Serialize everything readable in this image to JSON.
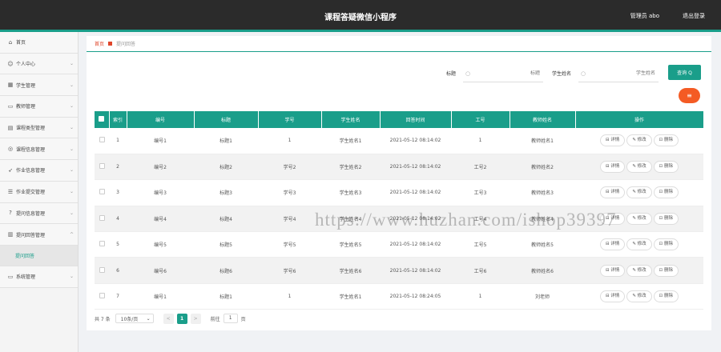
{
  "header": {
    "title": "课程答疑微信小程序",
    "user": "管理员 abo",
    "logout": "退出登录"
  },
  "sidebar": {
    "items": [
      {
        "label": "首页",
        "icon": "home-icon",
        "glyph": "⌂"
      },
      {
        "label": "个人中心",
        "icon": "person-icon",
        "glyph": "☺"
      },
      {
        "label": "学生管理",
        "icon": "grid-icon",
        "glyph": "▦"
      },
      {
        "label": "教师管理",
        "icon": "card-icon",
        "glyph": "▭"
      },
      {
        "label": "课程类型管理",
        "icon": "list-icon",
        "glyph": "▤"
      },
      {
        "label": "课程信息管理",
        "icon": "globe-icon",
        "glyph": "◎"
      },
      {
        "label": "作业信息管理",
        "icon": "send-icon",
        "glyph": "➶"
      },
      {
        "label": "作业提交管理",
        "icon": "stack-icon",
        "glyph": "☰"
      },
      {
        "label": "提问信息管理",
        "icon": "question-icon",
        "glyph": "?"
      },
      {
        "label": "提问回答管理",
        "icon": "doc-icon",
        "glyph": "▥"
      }
    ],
    "sub_item": "提问回答",
    "last_item": {
      "label": "系统管理",
      "icon": "monitor-icon",
      "glyph": "▭"
    }
  },
  "breadcrumb": {
    "home": "首页",
    "current": "提问回答"
  },
  "search": {
    "title_label": "标题",
    "title_placeholder": "标题",
    "student_label": "学生姓名",
    "student_placeholder": "学生姓名",
    "query_button": "查询 Q"
  },
  "delete_all_glyph": "≡",
  "table": {
    "columns": [
      "索引",
      "编号",
      "标题",
      "学号",
      "学生姓名",
      "回答时间",
      "工号",
      "教师姓名",
      "操作"
    ],
    "rows": [
      {
        "index": "1",
        "code": "编号1",
        "title": "标题1",
        "student_no": "1",
        "student_name": "学生姓名1",
        "time": "2021-05-12 08:14:02",
        "emp_no": "1",
        "teacher": "教师姓名1"
      },
      {
        "index": "2",
        "code": "编号2",
        "title": "标题2",
        "student_no": "学号2",
        "student_name": "学生姓名2",
        "time": "2021-05-12 08:14:02",
        "emp_no": "工号2",
        "teacher": "教师姓名2"
      },
      {
        "index": "3",
        "code": "编号3",
        "title": "标题3",
        "student_no": "学号3",
        "student_name": "学生姓名3",
        "time": "2021-05-12 08:14:02",
        "emp_no": "工号3",
        "teacher": "教师姓名3"
      },
      {
        "index": "4",
        "code": "编号4",
        "title": "标题4",
        "student_no": "学号4",
        "student_name": "学生姓名4",
        "time": "2021-05-12 08:14:02",
        "emp_no": "工号4",
        "teacher": "教师姓名4"
      },
      {
        "index": "5",
        "code": "编号5",
        "title": "标题5",
        "student_no": "学号5",
        "student_name": "学生姓名5",
        "time": "2021-05-12 08:14:02",
        "emp_no": "工号5",
        "teacher": "教师姓名5"
      },
      {
        "index": "6",
        "code": "编号6",
        "title": "标题6",
        "student_no": "学号6",
        "student_name": "学生姓名6",
        "time": "2021-05-12 08:14:02",
        "emp_no": "工号6",
        "teacher": "教师姓名6"
      },
      {
        "index": "7",
        "code": "编号1",
        "title": "标题1",
        "student_no": "1",
        "student_name": "学生姓名1",
        "time": "2021-05-12 08:24:05",
        "emp_no": "1",
        "teacher": "刘老师"
      }
    ],
    "actions": {
      "detail": "⊟ 详情",
      "edit": "✎ 修改",
      "delete": "⊡ 删除"
    }
  },
  "pager": {
    "total": "共 7 条",
    "size": "10条/页",
    "prev": "<",
    "current": "1",
    "next": ">",
    "goto_label": "前往",
    "goto_value": "1",
    "page_unit": "页"
  },
  "watermark": "https://www.huzhan.com/ishop39397",
  "colors": {
    "accent": "#1a9e8a",
    "danger": "#f45b24",
    "header": "#2b2b2b"
  }
}
